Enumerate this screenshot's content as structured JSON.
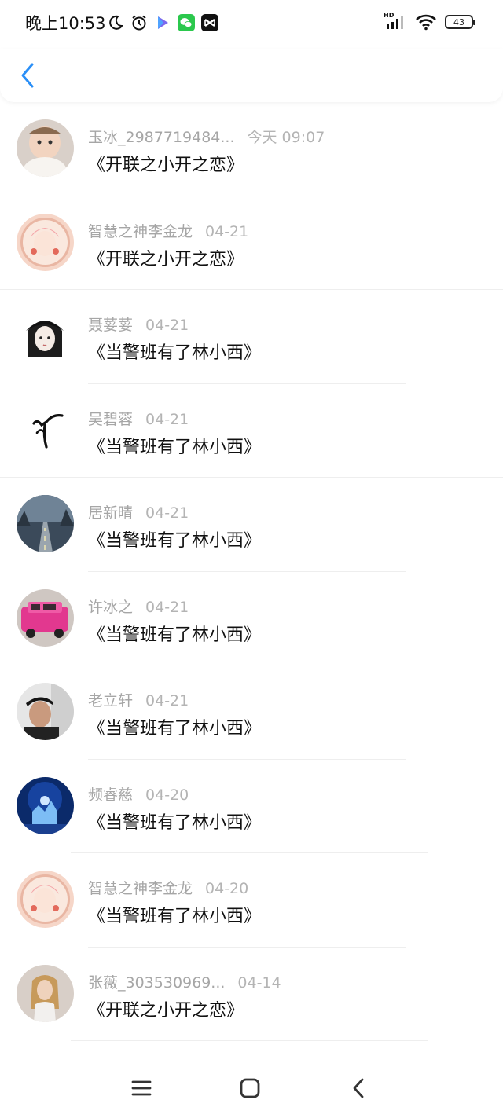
{
  "status_bar": {
    "time": "晚上10:53",
    "battery": "43",
    "network": "HD",
    "left_icons": [
      "moon-icon",
      "alarm-icon",
      "video-app-icon",
      "wechat-icon",
      "capcut-icon"
    ],
    "right_icons": [
      "signal-icon",
      "wifi-icon",
      "battery-icon"
    ]
  },
  "header": {
    "back_icon": "chevron-left-icon",
    "accent_color": "#2a8ff7"
  },
  "messages": [
    {
      "user": "玉冰_2987719484...",
      "date": "今天 09:07",
      "title": "《开联之小开之恋》"
    },
    {
      "user": "智慧之神李金龙",
      "date": "04-21",
      "title": "《开联之小开之恋》"
    },
    {
      "user": "聂荽荽",
      "date": "04-21",
      "title": "《当警班有了林小西》"
    },
    {
      "user": "吴碧蓉",
      "date": "04-21",
      "title": "《当警班有了林小西》"
    },
    {
      "user": "居新晴",
      "date": "04-21",
      "title": "《当警班有了林小西》"
    },
    {
      "user": "许冰之",
      "date": "04-21",
      "title": "《当警班有了林小西》"
    },
    {
      "user": "老立轩",
      "date": "04-21",
      "title": "《当警班有了林小西》"
    },
    {
      "user": "频睿慈",
      "date": "04-20",
      "title": "《当警班有了林小西》"
    },
    {
      "user": "智慧之神李金龙",
      "date": "04-20",
      "title": "《当警班有了林小西》"
    },
    {
      "user": "张薇_303530969...",
      "date": "04-14",
      "title": "《开联之小开之恋》"
    }
  ],
  "bottom_nav": {
    "icons": [
      "menu-icon",
      "home-icon",
      "back-icon"
    ]
  }
}
